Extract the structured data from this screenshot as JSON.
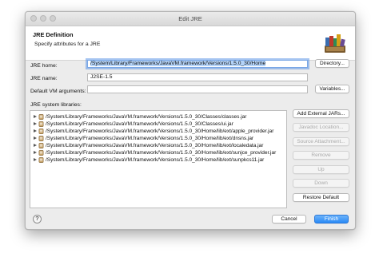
{
  "window": {
    "title": "Edit JRE"
  },
  "header": {
    "title": "JRE Definition",
    "subtitle": "Specify attributes for a JRE"
  },
  "form": {
    "jre_home_label": "JRE home:",
    "jre_home_value": "/System/Library/Frameworks/JavaVM.framework/Versions/1.5.0_30/Home",
    "directory_button": "Directory...",
    "jre_name_label": "JRE name:",
    "jre_name_value": "J2SE-1.5",
    "vm_args_label": "Default VM arguments:",
    "vm_args_value": "",
    "variables_button": "Variables...",
    "libraries_label": "JRE system libraries:"
  },
  "libraries": [
    "/System/Library/Frameworks/JavaVM.framework/Versions/1.5.0_30/Classes/classes.jar",
    "/System/Library/Frameworks/JavaVM.framework/Versions/1.5.0_30/Classes/ui.jar",
    "/System/Library/Frameworks/JavaVM.framework/Versions/1.5.0_30/Home/lib/ext/apple_provider.jar",
    "/System/Library/Frameworks/JavaVM.framework/Versions/1.5.0_30/Home/lib/ext/dnsns.jar",
    "/System/Library/Frameworks/JavaVM.framework/Versions/1.5.0_30/Home/lib/ext/localedata.jar",
    "/System/Library/Frameworks/JavaVM.framework/Versions/1.5.0_30/Home/lib/ext/sunjce_provider.jar",
    "/System/Library/Frameworks/JavaVM.framework/Versions/1.5.0_30/Home/lib/ext/sunpkcs11.jar"
  ],
  "side_buttons": {
    "add_external_jars": "Add External JARs...",
    "javadoc_location": "Javadoc Location...",
    "source_attachment": "Source Attachment...",
    "remove": "Remove",
    "up": "Up",
    "down": "Down",
    "restore_default": "Restore Default"
  },
  "footer": {
    "help": "?",
    "cancel": "Cancel",
    "finish": "Finish"
  },
  "icons": {
    "header": "books-icon",
    "jar": "jar-icon",
    "expand": "triangle-right-icon"
  },
  "colors": {
    "accent": "#2a8af6",
    "focus": "#7aa7e6"
  }
}
